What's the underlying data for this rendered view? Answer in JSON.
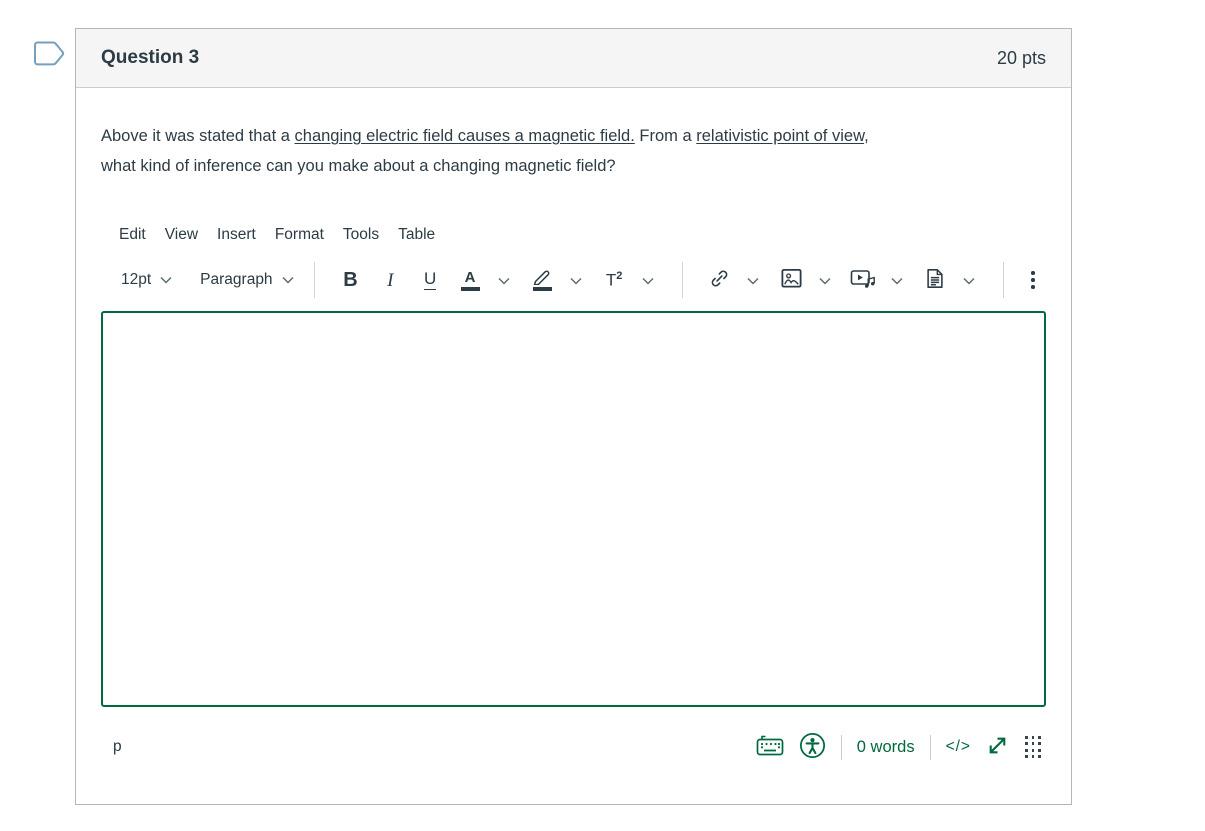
{
  "colors": {
    "brand_green": "#00693E",
    "ink": "#2D3B45",
    "header_bg": "#F5F5F5",
    "card_border": "#B3B7BA",
    "flag_blue": "#76A0B8"
  },
  "question": {
    "title": "Question 3",
    "points": "20 pts",
    "text": {
      "p1": "Above it was stated that a ",
      "u1": "changing electric field causes a magnetic field.",
      "p2": " From a ",
      "u2": "relativistic point of view",
      "p3": ",",
      "p4": "what kind of inference can you make about a changing magnetic field?"
    }
  },
  "editor": {
    "menu": [
      "Edit",
      "View",
      "Insert",
      "Format",
      "Tools",
      "Table"
    ],
    "toolbar": {
      "font_size": "12pt",
      "paragraph_style": "Paragraph",
      "bold_glyph": "B",
      "italic_glyph": "I",
      "underline_glyph": "U",
      "text_color_glyph": "A",
      "superscript_base": "T",
      "superscript_exponent": "2"
    },
    "status": {
      "element_path": "p",
      "word_count": "0 words",
      "html_toggle": "</>"
    },
    "icons": {
      "bookmark": "tag-outline",
      "chevron_down": "v",
      "more_options": "vertical-ellipsis",
      "keyboard_shortcuts": "keyboard",
      "accessibility_checker": "person-in-circle",
      "html_view": "</>",
      "resize": "diagonal-double-arrow",
      "drag_handle": "dot-grid"
    }
  }
}
